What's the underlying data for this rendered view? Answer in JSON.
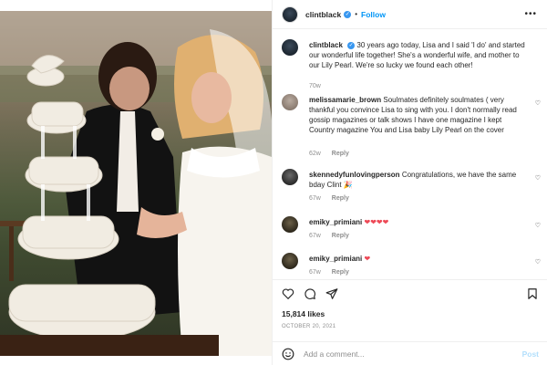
{
  "post": {
    "username": "clintblack",
    "follow_label": "Follow",
    "verified_mark": "✓",
    "separator": "•",
    "more_label": "•••"
  },
  "caption": {
    "username": "clintblack",
    "verified_mark": "✓",
    "text": "30 years ago today, Lisa and I said 'I do' and started our wonderful life together! She's a wonderful wife, and mother to our Lily Pearl. We're so lucky we found each other!",
    "time": "70w"
  },
  "comments": [
    {
      "username": "melissamarie_brown",
      "text": "Soulmates definitely soulmates ( very thankful you convince Lisa to sing with you. I don't normally read gossip magazines or talk shows I have one magazine I kept Country magazine You and Lisa baby Lily Pearl on the cover",
      "time": "62w",
      "reply": "Reply"
    },
    {
      "username": "skennedyfunlovingperson",
      "text": "Congratulations, we have the same bday Clint 🎉",
      "time": "67w",
      "reply": "Reply"
    },
    {
      "username": "emiky_primiani",
      "text": "❤❤❤❤",
      "time": "67w",
      "reply": "Reply"
    },
    {
      "username": "emiky_primiani",
      "text": "❤",
      "time": "67w",
      "reply": "Reply"
    }
  ],
  "actions": {
    "likes": "15,814 likes",
    "date": "OCTOBER 20, 2021"
  },
  "add_comment": {
    "placeholder": "Add a comment...",
    "post_label": "Post"
  },
  "colors": {
    "accent": "#0095f6",
    "verified": "#3897f0",
    "heart_red": "#ed4956",
    "post_disabled": "#b2dffc"
  }
}
